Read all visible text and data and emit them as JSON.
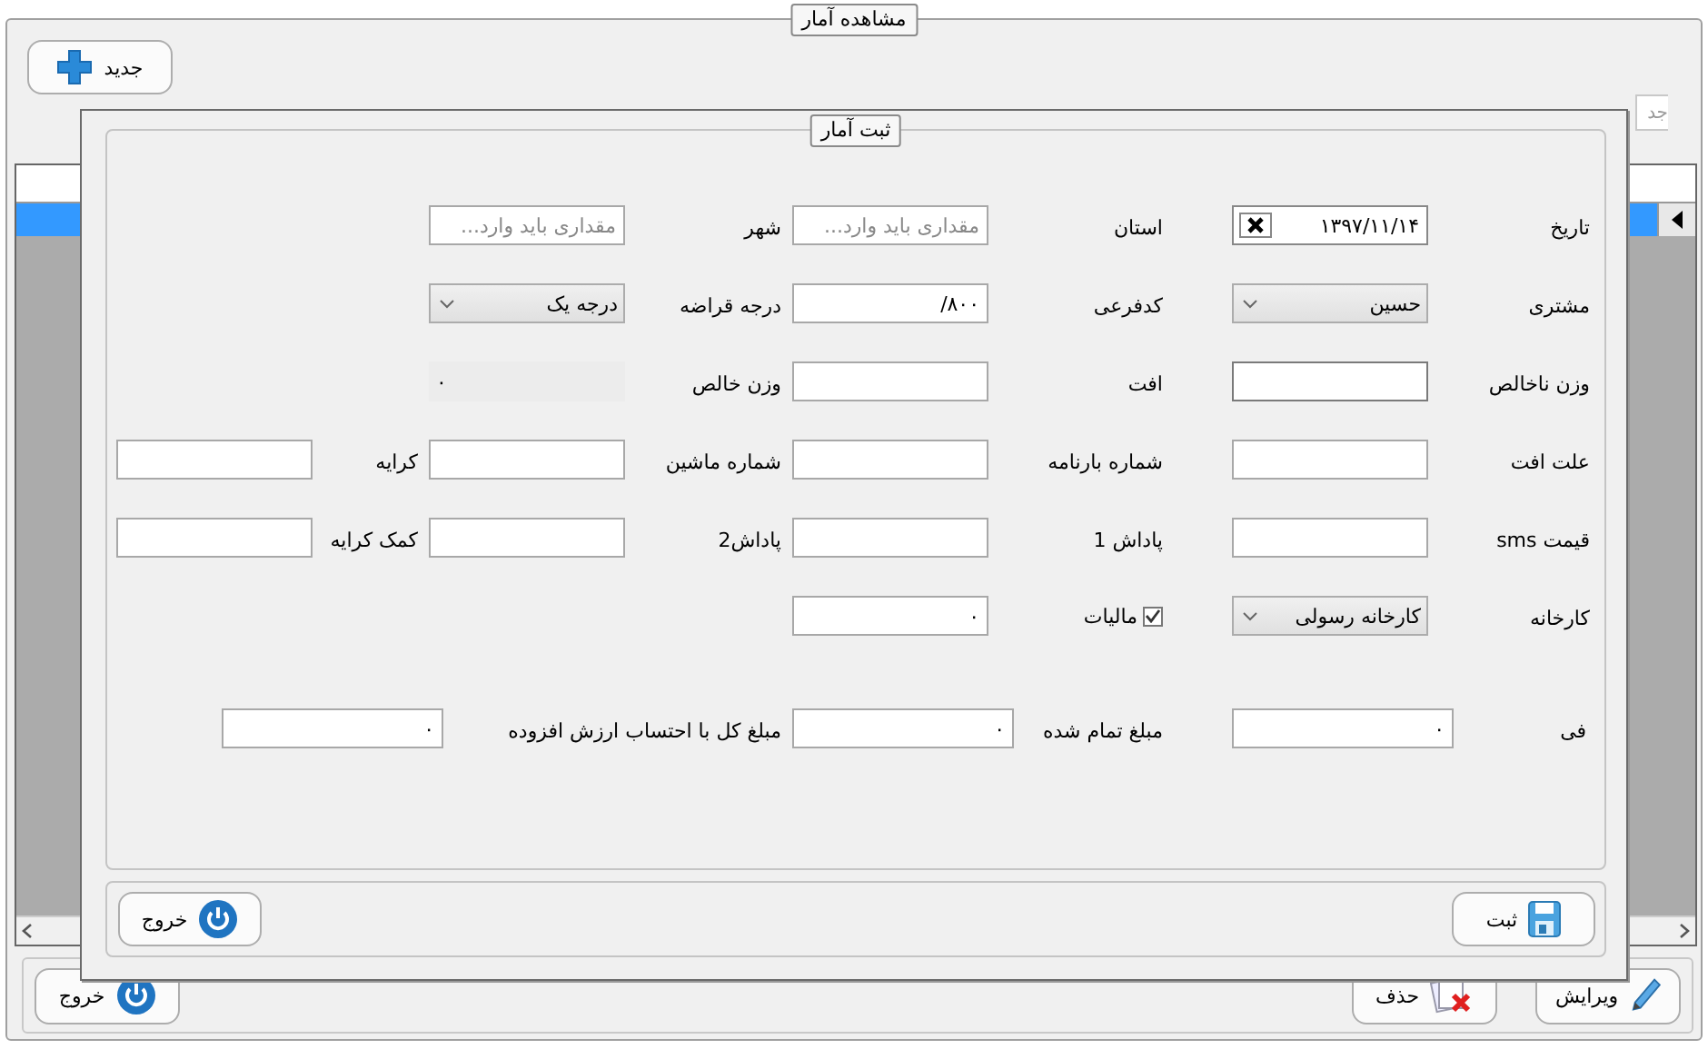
{
  "window": {
    "title": "مشاهده آمار"
  },
  "toolbar": {
    "new_button": "جدید",
    "search_field": {
      "placeholder": "جد"
    }
  },
  "grid": {
    "rows": [
      {
        "selected": true
      }
    ]
  },
  "bottom_buttons": [
    {
      "kind": "edit",
      "label": "ویرایش"
    },
    {
      "kind": "delete",
      "label": "حذف"
    },
    {
      "kind": "exit",
      "label": "خروج"
    }
  ],
  "dialog": {
    "title": "ثبت آمار",
    "rows": [
      [
        {
          "label": "تاریخ",
          "field": {
            "kind": "date",
            "value": "۱۳۹۷/۱۱/۱۴"
          }
        },
        {
          "label": "استان",
          "field": {
            "kind": "text",
            "placeholder": "مقداری باید وارد..."
          }
        },
        {
          "label": "شهر",
          "field": {
            "kind": "text",
            "placeholder": "مقداری باید وارد..."
          }
        }
      ],
      [
        {
          "label": "مشتری",
          "field": {
            "kind": "combo",
            "value": "حسین"
          }
        },
        {
          "label": "کدفرعی",
          "field": {
            "kind": "text",
            "value": "/۸۰۰"
          }
        },
        {
          "label": "درجه قراضه",
          "field": {
            "kind": "combo",
            "value": "درجه یک"
          }
        }
      ],
      [
        {
          "label": "وزن ناخالص",
          "field": {
            "kind": "text"
          }
        },
        {
          "label": "افت",
          "field": {
            "kind": "text"
          }
        },
        {
          "label": "وزن خالص",
          "field": {
            "kind": "readonly",
            "value": "۰"
          }
        }
      ],
      [
        {
          "label": "علت افت",
          "field": {
            "kind": "text"
          }
        },
        {
          "label": "شماره بارنامه",
          "field": {
            "kind": "text"
          }
        },
        {
          "label": "شماره ماشین",
          "field": {
            "kind": "text"
          }
        },
        {
          "label": "کرایه",
          "field": {
            "kind": "text"
          }
        }
      ],
      [
        {
          "label": "قیمت sms",
          "field": {
            "kind": "text"
          }
        },
        {
          "label": "پاداش 1",
          "field": {
            "kind": "text"
          }
        },
        {
          "label": "پاداش2",
          "field": {
            "kind": "text"
          }
        },
        {
          "label": "کمک کرایه",
          "field": {
            "kind": "text"
          }
        }
      ],
      [
        {
          "label": "کارخانه",
          "field": {
            "kind": "combo",
            "value": "کارخانه رسولی"
          }
        },
        {
          "label": "مالیات",
          "checked": true,
          "field": {
            "kind": "text",
            "value": "۰"
          }
        }
      ]
    ],
    "totals": [
      {
        "label": "فی",
        "value": "۰"
      },
      {
        "label": "مبلغ تمام شده",
        "value": "۰"
      },
      {
        "label": "مبلغ کل با احتساب ارزش افزوده",
        "value": "۰"
      }
    ],
    "buttons": [
      {
        "kind": "save",
        "label": "ثبت"
      },
      {
        "kind": "exit",
        "label": "خروج"
      }
    ]
  }
}
